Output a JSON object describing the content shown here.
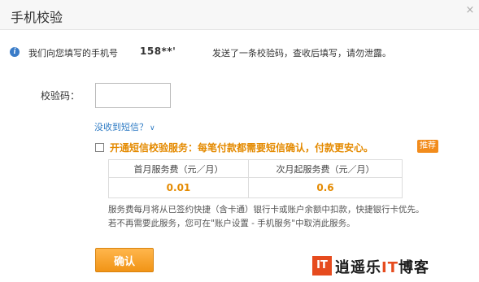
{
  "dialog": {
    "title": "手机校验",
    "close_glyph": "×"
  },
  "notice": {
    "icon": "info-icon",
    "text_before": "我们向您填写的手机号",
    "phone": "158**'",
    "text_after": "发送了一条校验码，查收后填写，请勿泄露。"
  },
  "form": {
    "code_label": "校验码：",
    "code_value": "",
    "no_sms_link": "没收到短信？",
    "no_sms_chevron": "∨"
  },
  "service": {
    "checked": false,
    "label": "开通短信校验服务：每笔付款都需要短信确认，付款更安心。",
    "badge": "推荐",
    "table_headers": [
      "首月服务费（元／月）",
      "次月起服务费（元／月）"
    ],
    "table_values": [
      "0.01",
      "0.6"
    ],
    "desc_line1": "服务费每月将从已签约快捷（含卡通）银行卡或账户余额中扣款，快捷银行卡优先。",
    "desc_line2": "若不再需要此服务，您可在\"账户设置 - 手机服务\"中取消此服务。"
  },
  "actions": {
    "confirm_label": "确认"
  },
  "watermark": {
    "logo_text": "IT",
    "text_main": "逍遥乐",
    "text_hl": "IT",
    "text_tail": "博客"
  },
  "colors": {
    "accent_orange": "#e48a00",
    "link_blue": "#2e7bc4",
    "button_orange": "#f19416"
  }
}
